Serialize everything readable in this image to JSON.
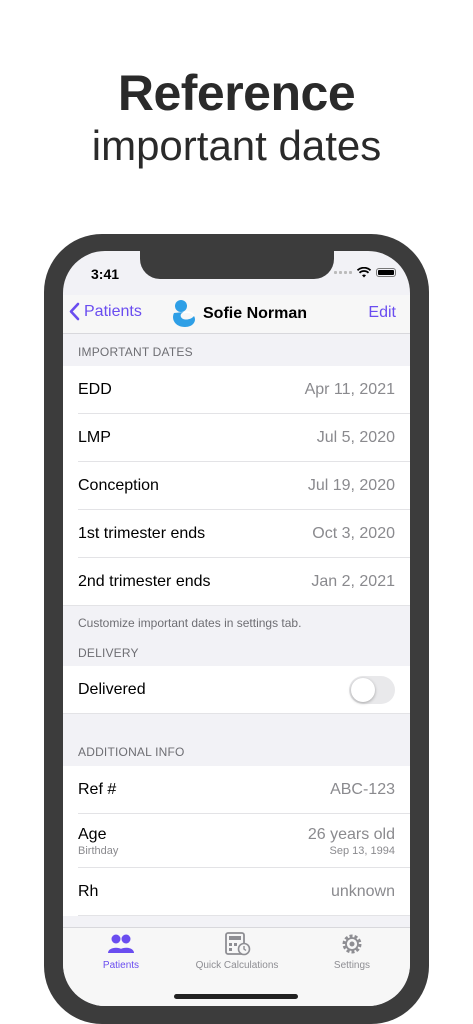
{
  "promo": {
    "line1": "Reference",
    "line2": "important dates"
  },
  "status": {
    "time": "3:41"
  },
  "nav": {
    "back_label": "Patients",
    "title": "Sofie Norman",
    "edit_label": "Edit"
  },
  "important_dates": {
    "header": "IMPORTANT DATES",
    "rows": [
      {
        "label": "EDD",
        "value": "Apr 11, 2021"
      },
      {
        "label": "LMP",
        "value": "Jul 5, 2020"
      },
      {
        "label": "Conception",
        "value": "Jul 19, 2020"
      },
      {
        "label": "1st trimester ends",
        "value": "Oct 3, 2020"
      },
      {
        "label": "2nd trimester ends",
        "value": "Jan 2, 2021"
      }
    ],
    "footer": "Customize important dates in settings tab."
  },
  "delivery": {
    "header": "DELIVERY",
    "delivered_label": "Delivered",
    "delivered_on": false
  },
  "additional_info": {
    "header": "ADDITIONAL INFO",
    "ref_label": "Ref #",
    "ref_value": "ABC-123",
    "age_label": "Age",
    "age_sub": "Birthday",
    "age_value": "26 years old",
    "birthday_value": "Sep 13, 1994",
    "rh_label": "Rh",
    "rh_value": "unknown"
  },
  "tabs": [
    {
      "label": "Patients",
      "icon": "patients-icon",
      "active": true
    },
    {
      "label": "Quick Calculations",
      "icon": "calculator-icon",
      "active": false
    },
    {
      "label": "Settings",
      "icon": "gear-icon",
      "active": false
    }
  ],
  "colors": {
    "accent": "#6a4df0",
    "avatar": "#2e9fe6"
  }
}
